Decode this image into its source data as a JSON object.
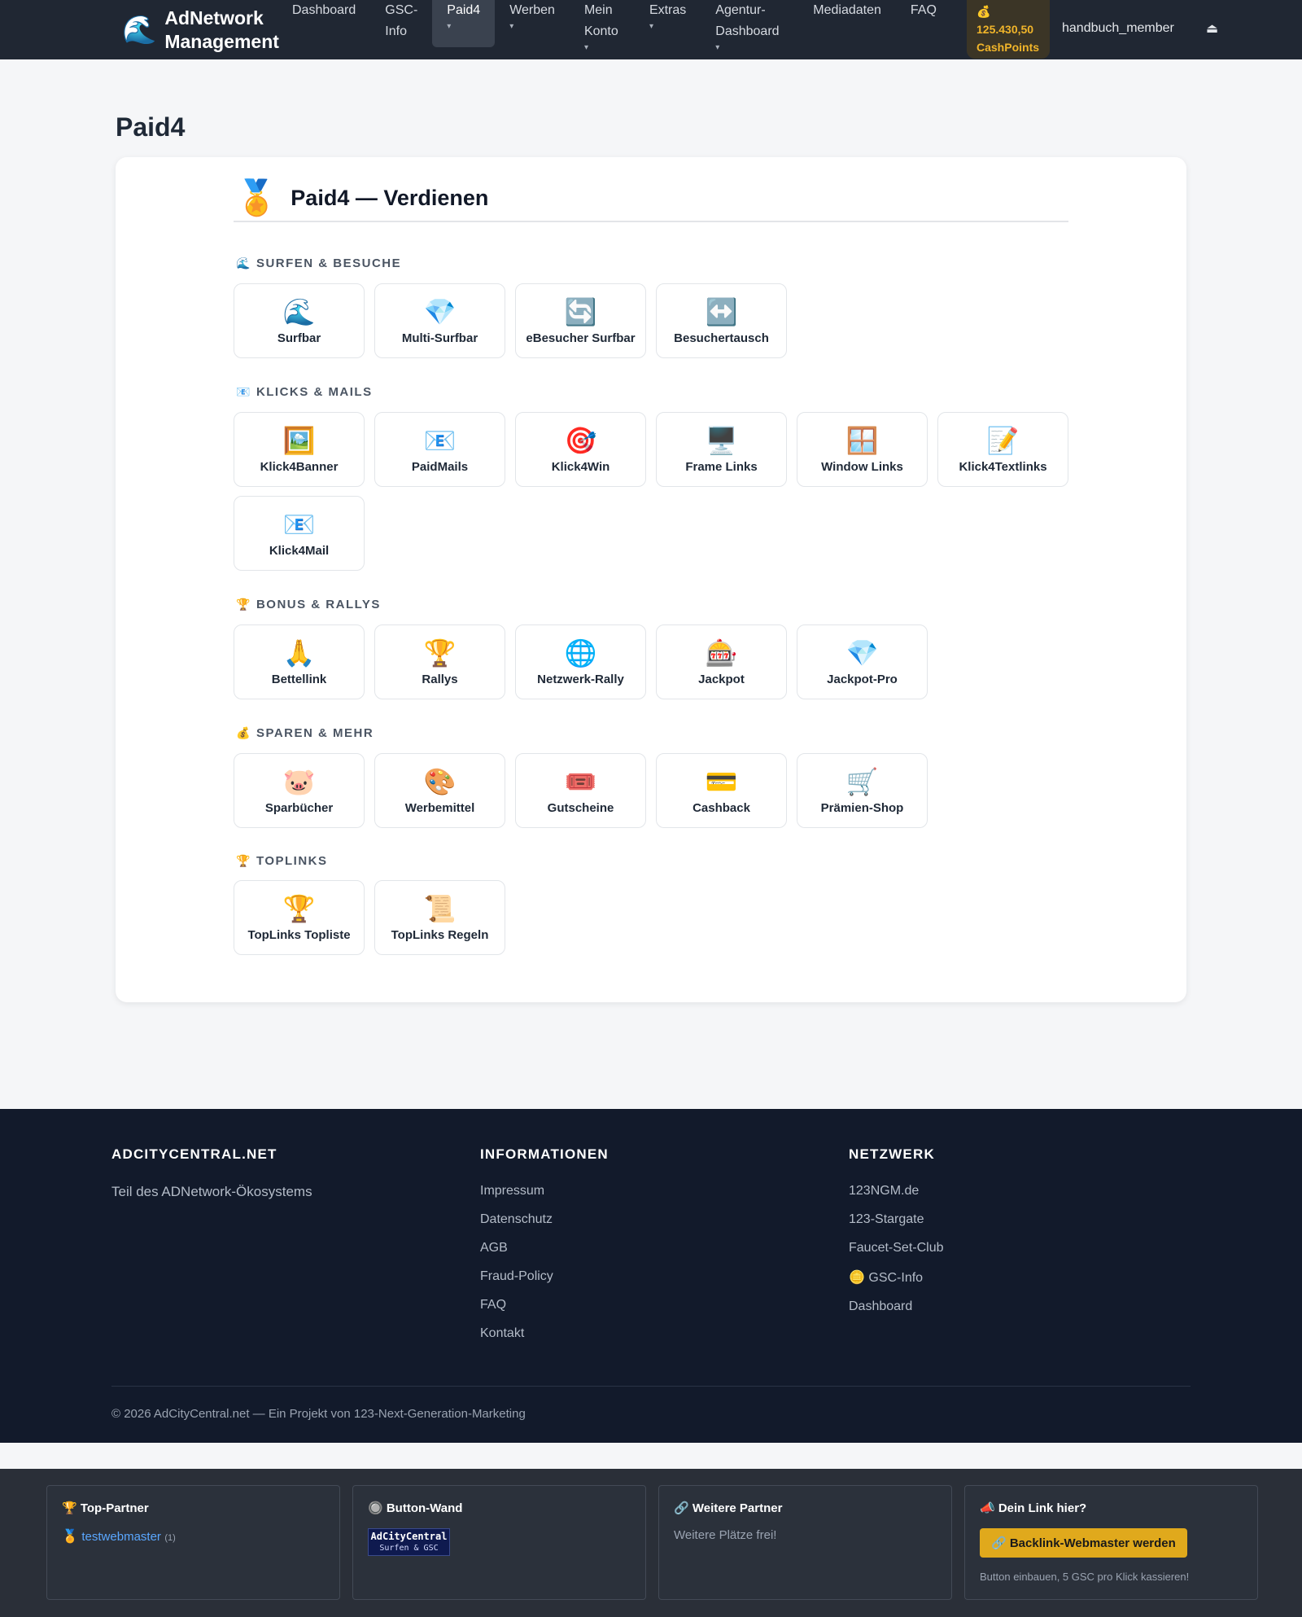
{
  "navbar": {
    "brand_icon": "🌊",
    "brand": "AdNetwork Management",
    "items": [
      {
        "label": "Dashboard",
        "caret": ""
      },
      {
        "label": "GSC-Info",
        "caret": ""
      },
      {
        "label": "Paid4",
        "caret": "▾"
      },
      {
        "label": "Werben",
        "caret": "▾"
      },
      {
        "label": "Mein Konto",
        "caret": "▾"
      },
      {
        "label": "Extras",
        "caret": "▾"
      },
      {
        "label": "Agentur-Dashboard",
        "caret": "▾"
      },
      {
        "label": "Mediadaten",
        "caret": ""
      },
      {
        "label": "FAQ",
        "caret": ""
      }
    ],
    "cash_icon": "💰",
    "cash_amount": "125.430,50",
    "cash_label": "CashPoints",
    "username": "handbuch_member",
    "logout_icon": "⏏"
  },
  "page": {
    "title": "Paid4",
    "card_icon": "🏅",
    "card_title": "Paid4 — Verdienen"
  },
  "sections": [
    {
      "icon": "🌊",
      "title": "SURFEN & BESUCHE",
      "tiles": [
        {
          "icon": "🌊",
          "label": "Surfbar"
        },
        {
          "icon": "💎",
          "label": "Multi-Surfbar"
        },
        {
          "icon": "🔄",
          "label": "eBesucher Surfbar"
        },
        {
          "icon": "↔️",
          "label": "Besuchertausch"
        }
      ]
    },
    {
      "icon": "📧",
      "title": "KLICKS & MAILS",
      "tiles": [
        {
          "icon": "🖼️",
          "label": "Klick4Banner"
        },
        {
          "icon": "📧",
          "label": "PaidMails"
        },
        {
          "icon": "🎯",
          "label": "Klick4Win"
        },
        {
          "icon": "🖥️",
          "label": "Frame Links"
        },
        {
          "icon": "🪟",
          "label": "Window Links"
        },
        {
          "icon": "📝",
          "label": "Klick4Textlinks"
        },
        {
          "icon": "📧",
          "label": "Klick4Mail"
        }
      ]
    },
    {
      "icon": "🏆",
      "title": "BONUS & RALLYS",
      "tiles": [
        {
          "icon": "🙏",
          "label": "Bettellink"
        },
        {
          "icon": "🏆",
          "label": "Rallys"
        },
        {
          "icon": "🌐",
          "label": "Netzwerk-Rally"
        },
        {
          "icon": "🎰",
          "label": "Jackpot"
        },
        {
          "icon": "💎",
          "label": "Jackpot-Pro"
        }
      ]
    },
    {
      "icon": "💰",
      "title": "SPAREN & MEHR",
      "tiles": [
        {
          "icon": "🐷",
          "label": "Sparbücher"
        },
        {
          "icon": "🎨",
          "label": "Werbemittel"
        },
        {
          "icon": "🎟️",
          "label": "Gutscheine"
        },
        {
          "icon": "💳",
          "label": "Cashback"
        },
        {
          "icon": "🛒",
          "label": "Prämien-Shop"
        }
      ]
    },
    {
      "icon": "🏆",
      "title": "TOPLINKS",
      "tiles": [
        {
          "icon": "🏆",
          "label": "TopLinks Topliste"
        },
        {
          "icon": "📜",
          "label": "TopLinks Regeln"
        }
      ]
    }
  ],
  "footer": {
    "col1_title": "ADCITYCENTRAL.NET",
    "col1_text": "Teil des ADNetwork-Ökosystems",
    "col2_title": "INFORMATIONEN",
    "col2_links": [
      "Impressum",
      "Datenschutz",
      "AGB",
      "Fraud-Policy",
      "FAQ",
      "Kontakt"
    ],
    "col3_title": "NETZWERK",
    "col3_links": [
      "123NGM.de",
      "123-Stargate",
      "Faucet-Set-Club",
      "🪙 GSC-Info",
      "Dashboard"
    ],
    "copyright": "© 2026 AdCityCentral.net — Ein Projekt von 123-Next-Generation-Marketing"
  },
  "bottom": {
    "partners_title": "🏆 Top-Partner",
    "partner_icon": "🏅",
    "partner_name": "testwebmaster",
    "partner_count": "(1)",
    "wall_title": "🔘 Button-Wand",
    "wall_banner_line1": "AdCityCentral",
    "wall_banner_line2": "Surfen & GSC",
    "more_title": "🔗 Weitere Partner",
    "more_text": "Weitere Plätze frei!",
    "link_title": "📣 Dein Link hier?",
    "link_button": "🔗 Backlink-Webmaster werden",
    "link_note": "Button einbauen, 5 GSC pro Klick kassieren!"
  }
}
